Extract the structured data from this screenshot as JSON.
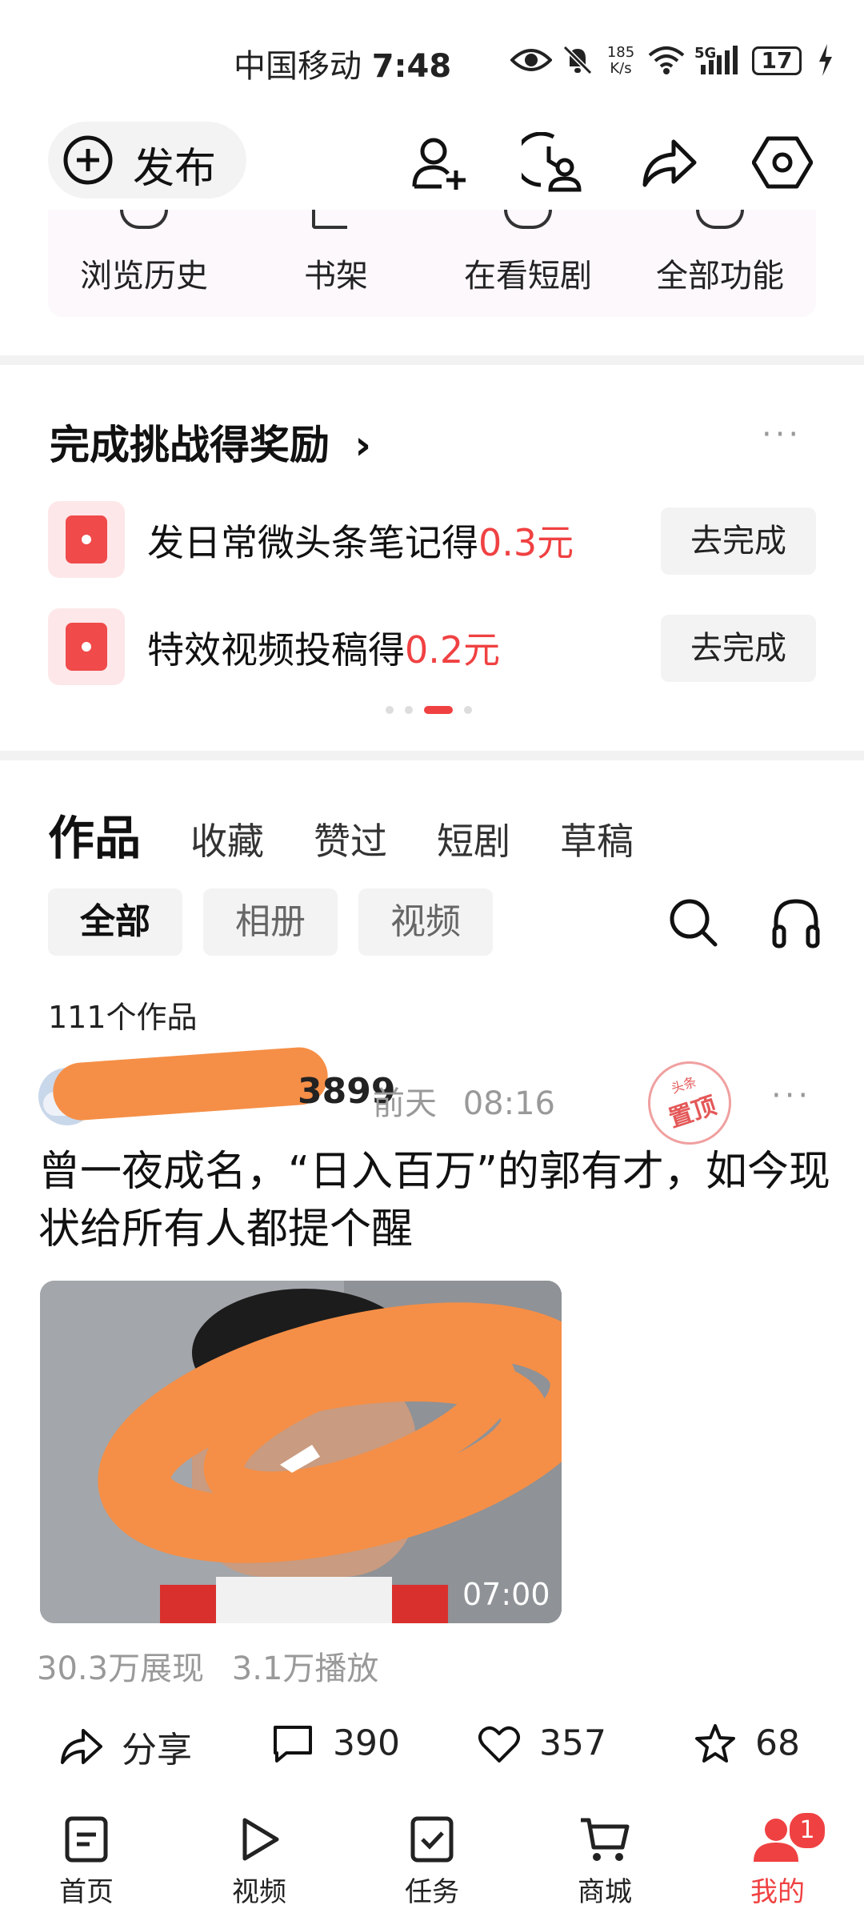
{
  "status_bar": {
    "carrier": "中国移动",
    "time": "7:48",
    "speed_value": "185",
    "speed_unit": "K/s",
    "network": "5G",
    "battery": "17"
  },
  "header": {
    "publish_label": "发布",
    "icons": [
      "add-friend-icon",
      "visitor-icon",
      "share-icon",
      "settings-icon"
    ]
  },
  "quick_functions": [
    "浏览历史",
    "书架",
    "在看短剧",
    "全部功能"
  ],
  "challenge": {
    "title": "完成挑战得奖励",
    "arrow": "›",
    "more": "···",
    "tasks": [
      {
        "text": "发日常微头条笔记得",
        "amount": "0.3元",
        "button": "去完成"
      },
      {
        "text": "特效视频投稿得",
        "amount": "0.2元",
        "button": "去完成"
      }
    ]
  },
  "content_tabs": [
    "作品",
    "收藏",
    "赞过",
    "短剧",
    "草稿"
  ],
  "filter_chips": [
    "全部",
    "相册",
    "视频"
  ],
  "works_count": "111个作品",
  "post": {
    "username_suffix": "3899",
    "time_label": "前天",
    "time": "08:16",
    "pinned_label": "置顶",
    "pinned_small": "头条",
    "title": "曾一夜成名，“日入百万”的郭有才，如今现状给所有人都提个醒",
    "duration": "07:00",
    "impressions": "30.3万展现",
    "plays": "3.1万播放",
    "share_label": "分享",
    "comments": "390",
    "likes": "357",
    "favorites": "68",
    "more": "···"
  },
  "bottom_nav": [
    {
      "label": "首页"
    },
    {
      "label": "视频"
    },
    {
      "label": "任务"
    },
    {
      "label": "商城"
    },
    {
      "label": "我的",
      "badge": "1"
    }
  ],
  "colors": {
    "accent": "#f04142",
    "scribble": "#f58f47",
    "chip_bg": "#f3f3f3"
  }
}
